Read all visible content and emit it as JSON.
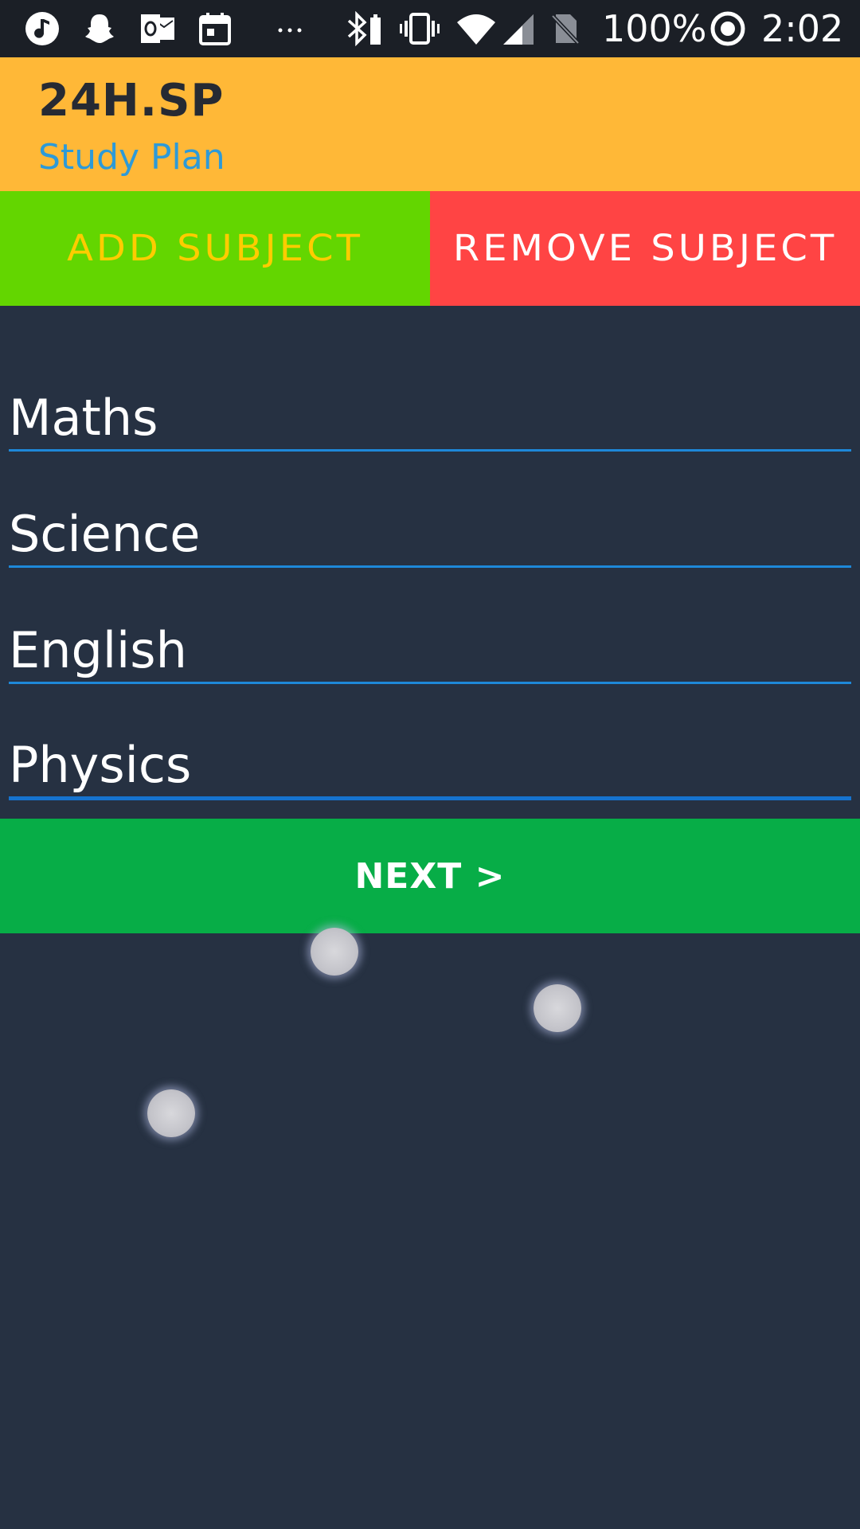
{
  "status_bar": {
    "battery": "100%",
    "time": "2:02",
    "icons": [
      "music-note-icon",
      "snapchat-icon",
      "outlook-icon",
      "calendar-icon",
      "more-dots-icon",
      "bluetooth-icon",
      "vibrate-icon",
      "wifi-icon",
      "cell-signal-icon",
      "no-sim-icon",
      "sync-icon"
    ]
  },
  "header": {
    "title": "24H.SP",
    "subtitle": "Study Plan"
  },
  "actions": {
    "add_label": "ADD SUBJECT",
    "remove_label": "REMOVE SUBJECT"
  },
  "subjects": [
    {
      "value": "Maths"
    },
    {
      "value": "Science"
    },
    {
      "value": "English"
    },
    {
      "value": "Physics"
    }
  ],
  "next_label": "NEXT >",
  "colors": {
    "header_bg": "#ffb837",
    "subtitle": "#2d9ad8",
    "add_bg": "#63d600",
    "add_text": "#ffcc00",
    "remove_bg": "#ff4444",
    "next_bg": "#07ad47",
    "page_bg": "#263142",
    "field_underline": "#1e88d8"
  }
}
